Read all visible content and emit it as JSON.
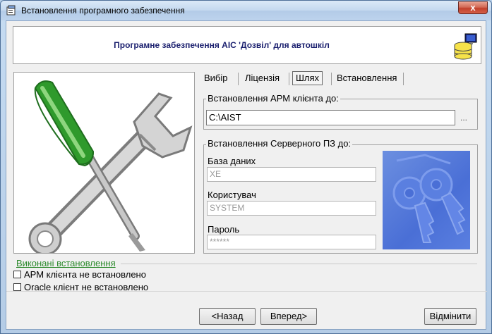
{
  "window": {
    "title": "Встановлення програмного забезпечення",
    "close_glyph": "x"
  },
  "header": {
    "text": "Програмне забезпечення АІС 'Дозвіл' для автошкіл",
    "icon": "database-computer-icon"
  },
  "tabs": [
    {
      "label": "Вибір",
      "active": false
    },
    {
      "label": "Ліцензія",
      "active": false
    },
    {
      "label": "Шлях",
      "active": true
    },
    {
      "label": "Встановлення",
      "active": false
    }
  ],
  "client_path": {
    "group_label": "Встановлення АРМ клієнта до:",
    "value": "C:\\AIST",
    "browse_label": "..."
  },
  "server": {
    "group_label": "Встановлення Серверного ПЗ до:",
    "database_label": "База даних",
    "database_value": "XE",
    "user_label": "Користувач",
    "user_value": "SYSTEM",
    "password_label": "Пароль",
    "password_value": "******",
    "image": "keys-icon"
  },
  "completed": {
    "label": "Виконані встановлення",
    "items": [
      {
        "label": "АРМ клієнта не встановлено",
        "checked": false
      },
      {
        "label": "Oracle клієнт не встановлено",
        "checked": false
      }
    ]
  },
  "buttons": {
    "back": "Назад",
    "next": "Вперед",
    "cancel": "Відмінити"
  },
  "colors": {
    "header_text": "#1a1f6e",
    "completed_label": "#2c8a2c",
    "screwdriver": "#3fa83a",
    "keys_panel": "#4a6fd6"
  }
}
